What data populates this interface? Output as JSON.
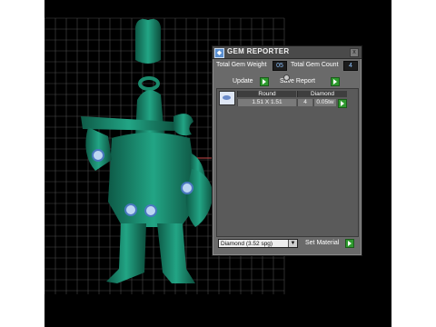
{
  "panel": {
    "title": "GEM REPORTER",
    "close_glyph": "x",
    "total_weight_label": "Total Gem Weight",
    "total_weight_value": "05",
    "total_count_label": "Total Gem Count",
    "total_count_value": "4",
    "update_label": "Update",
    "save_report_label": "Save Report",
    "table": {
      "headers": [
        "Round",
        "Diamond"
      ],
      "row": {
        "size": "1.51 X 1.51",
        "count": "4",
        "weight": "0.05tw"
      }
    },
    "material_value": "Diamond    (3.52 spg)",
    "set_material_label": "Set Material"
  },
  "icons": [
    "app-icon",
    "close-icon",
    "gem-round-icon",
    "play-arrow-icon",
    "dropdown-arrow-icon"
  ],
  "colors": {
    "model": "#1f9a78",
    "grid": "#4a4a4a",
    "accent_value": "#8ec3ff",
    "button_green": "#2e9a2e"
  }
}
